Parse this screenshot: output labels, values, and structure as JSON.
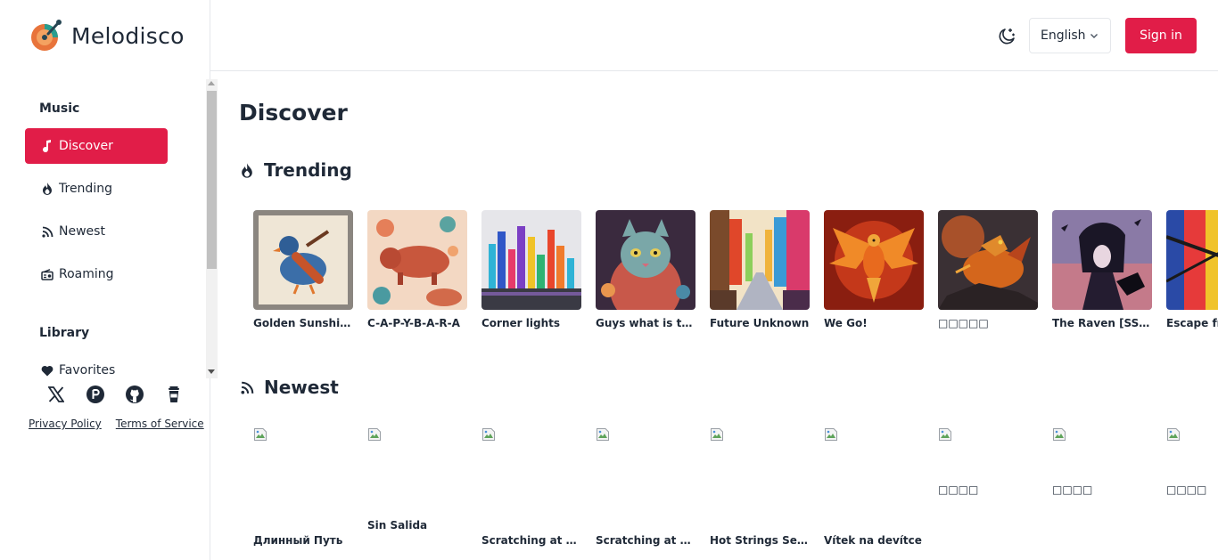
{
  "app": {
    "name": "Melodisco"
  },
  "sidebar": {
    "sections": [
      {
        "title": "Music"
      },
      {
        "title": "Library"
      }
    ],
    "items": [
      {
        "label": "Discover",
        "icon": "music-note-icon",
        "active": true
      },
      {
        "label": "Trending",
        "icon": "flame-icon",
        "active": false
      },
      {
        "label": "Newest",
        "icon": "rss-icon",
        "active": false
      },
      {
        "label": "Roaming",
        "icon": "radio-icon",
        "active": false
      },
      {
        "label": "Favorites",
        "icon": "heart-icon",
        "active": false
      }
    ],
    "socials": [
      "x-icon",
      "product-hunt-icon",
      "github-icon",
      "coffee-cup-icon"
    ],
    "footer": {
      "privacy": "Privacy Policy",
      "terms": "Terms of Service"
    }
  },
  "header": {
    "theme_icon": "moon-stars-icon",
    "language": "English",
    "signin": "Sign in"
  },
  "main": {
    "title": "Discover",
    "trending": {
      "title": "Trending",
      "items": [
        {
          "title": "Golden Sunshine"
        },
        {
          "title": "C-A-P-Y-B-A-R-A"
        },
        {
          "title": "Corner lights"
        },
        {
          "title": "Guys what is this"
        },
        {
          "title": "Future Unknown"
        },
        {
          "title": "We Go!"
        },
        {
          "title": "□□□□□"
        },
        {
          "title": "The Raven [SSR]"
        },
        {
          "title": "Escape from"
        }
      ]
    },
    "newest": {
      "title": "Newest",
      "items": [
        {
          "title": "Длинный Путь"
        },
        {
          "title": "Sin Salida"
        },
        {
          "title": "Scratching at the"
        },
        {
          "title": "Scratching at the"
        },
        {
          "title": "Hot Strings Session"
        },
        {
          "title": "Vítek na devítce"
        },
        {
          "title": "□□□□"
        },
        {
          "title": "□□□□"
        },
        {
          "title": "□□□□"
        }
      ]
    }
  },
  "colors": {
    "accent": "#e11d48",
    "text": "#1f2937",
    "border": "#e5e7eb"
  }
}
